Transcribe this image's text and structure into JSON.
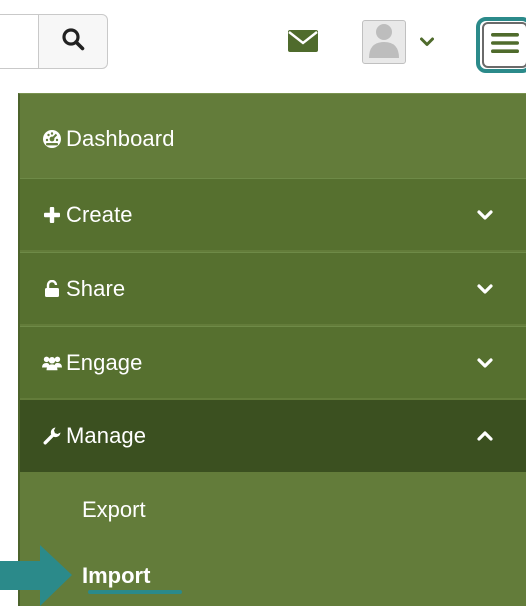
{
  "header": {
    "search_icon": "search-icon",
    "mail_icon": "envelope-icon",
    "avatar_icon": "user-silhouette-icon",
    "user_dropdown_icon": "chevron-down-icon",
    "menu_toggle_icon": "hamburger-icon"
  },
  "menu": {
    "items": [
      {
        "label": "Dashboard",
        "icon": "dashboard-icon",
        "expandable": false
      },
      {
        "label": "Create",
        "icon": "plus-icon",
        "expandable": true,
        "chevron": "chevron-down-icon"
      },
      {
        "label": "Share",
        "icon": "lock-icon",
        "expandable": true,
        "chevron": "chevron-down-icon"
      },
      {
        "label": "Engage",
        "icon": "users-icon",
        "expandable": true,
        "chevron": "chevron-down-icon"
      },
      {
        "label": "Manage",
        "icon": "wrench-icon",
        "expandable": true,
        "expanded": true,
        "chevron": "chevron-up-icon"
      }
    ],
    "manage_sub": [
      {
        "label": "Export"
      },
      {
        "label": "Import",
        "highlighted": true
      }
    ]
  },
  "colors": {
    "menu_bg": "#637c3a",
    "section_bg": "#56702f",
    "active_bg": "#3b5020",
    "accent": "#2b8a8a",
    "mail": "#4f6b2c"
  }
}
